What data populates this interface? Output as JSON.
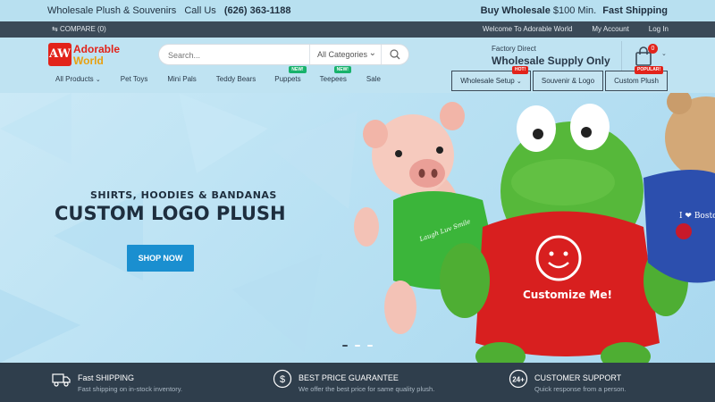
{
  "promo": {
    "left_text": "Wholesale Plush & Souvenirs",
    "call_label": "Call Us",
    "phone": "(626) 363-1188",
    "buy_wholesale": "Buy Wholesale",
    "min_text": "$100 Min.",
    "fast_shipping": "Fast Shipping"
  },
  "topbar": {
    "compare": "COMPARE (0)",
    "links": [
      "Welcome To Adorable World",
      "My Account",
      "Log In"
    ]
  },
  "logo": {
    "line1": "Adorable",
    "line2": "World",
    "mark": "AW"
  },
  "search": {
    "placeholder": "Search...",
    "category": "All Categories"
  },
  "factory": {
    "small": "Factory Direct",
    "big": "Wholesale Supply Only"
  },
  "cart": {
    "count": "0"
  },
  "menu": [
    {
      "label": "All Products",
      "chevron": true,
      "badge": ""
    },
    {
      "label": "Pet Toys",
      "chevron": false,
      "badge": ""
    },
    {
      "label": "Mini Pals",
      "chevron": false,
      "badge": ""
    },
    {
      "label": "Teddy Bears",
      "chevron": false,
      "badge": ""
    },
    {
      "label": "Puppets",
      "chevron": false,
      "badge": "NEW!"
    },
    {
      "label": "Teepees",
      "chevron": false,
      "badge": "NEW!"
    },
    {
      "label": "Sale",
      "chevron": false,
      "badge": ""
    }
  ],
  "buttons": {
    "wholesale_setup": "Wholesale Setup",
    "wholesale_badge": "HOT!",
    "souvenir_logo": "Souvenir & Logo",
    "custom_plush": "Custom Plush",
    "custom_badge": "POPULAR!"
  },
  "hero": {
    "subtitle": "SHIRTS, HOODIES & BANDANAS",
    "title": "CUSTOM LOGO PLUSH",
    "cta": "SHOP NOW",
    "shirt_text": "Customize Me!",
    "green_shirt_text": "Laugh Luv Smile",
    "bear_shirt_text": "I ❤ Boston"
  },
  "features": [
    {
      "icon": "truck-icon",
      "title": "Fast SHIPPING",
      "desc": "Fast shipping on in-stock inventory."
    },
    {
      "icon": "dollar-coin-icon",
      "title": "BEST PRICE GUARANTEE",
      "desc": "We offer the best price for same quality plush."
    },
    {
      "icon": "24-hour-support-icon",
      "title": "CUSTOMER SUPPORT",
      "desc": "Quick response from a person."
    }
  ],
  "colors": {
    "accent": "#1a8fd0",
    "brand_red": "#e2231a",
    "dark": "#2f3e4c",
    "new_badge": "#18b26b"
  }
}
